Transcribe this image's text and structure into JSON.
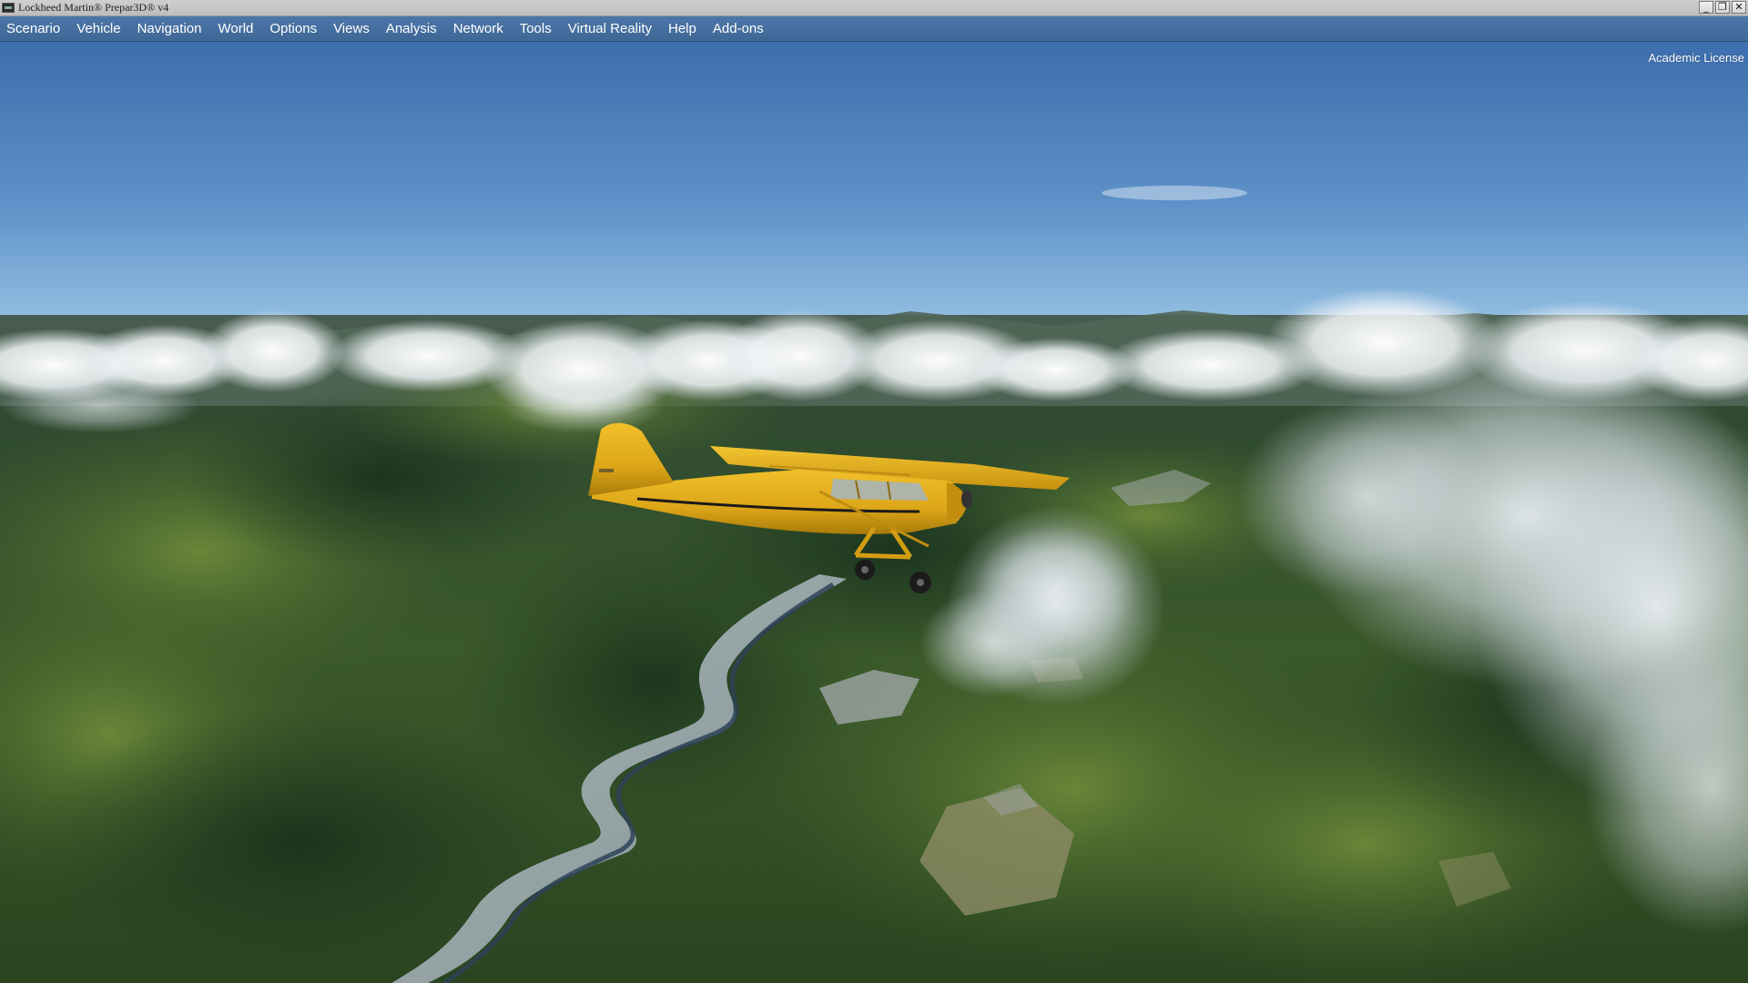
{
  "window": {
    "title": "Lockheed Martin® Prepar3D® v4",
    "controls": {
      "minimize": "_",
      "restore": "❐",
      "close": "✕"
    }
  },
  "menu": {
    "items": [
      {
        "label": "Scenario"
      },
      {
        "label": "Vehicle"
      },
      {
        "label": "Navigation"
      },
      {
        "label": "World"
      },
      {
        "label": "Options"
      },
      {
        "label": "Views"
      },
      {
        "label": "Analysis"
      },
      {
        "label": "Network"
      },
      {
        "label": "Tools"
      },
      {
        "label": "Virtual Reality"
      },
      {
        "label": "Help"
      },
      {
        "label": "Add-ons"
      }
    ]
  },
  "overlay": {
    "license": "Academic License"
  },
  "colors": {
    "menubar": "#4572a3",
    "sky_top": "#3f70b0",
    "sky_horizon": "#a9cde8",
    "terrain_dark": "#1f3a22",
    "terrain_light": "#5d7d34",
    "aircraft": "#e3b21c"
  }
}
